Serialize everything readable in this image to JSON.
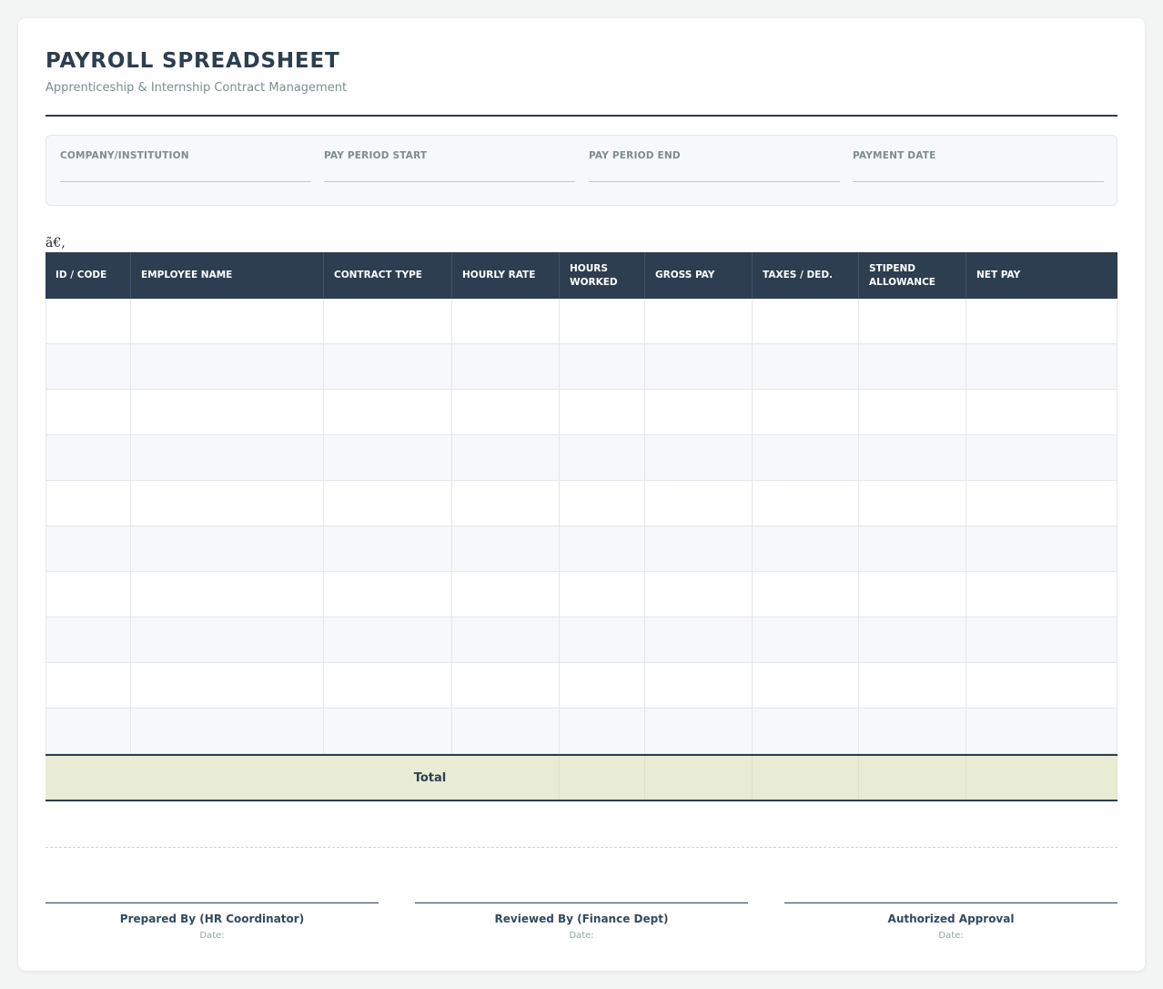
{
  "header": {
    "title": "PAYROLL SPREADSHEET",
    "subtitle": "Apprenticeship & Internship Contract Management"
  },
  "meta_fields": [
    {
      "label": "COMPANY/INSTITUTION",
      "value": ""
    },
    {
      "label": "PAY PERIOD START",
      "value": ""
    },
    {
      "label": "PAY PERIOD END",
      "value": ""
    },
    {
      "label": "PAYMENT DATE",
      "value": ""
    }
  ],
  "stray_text": "ã€‚",
  "table": {
    "columns": [
      {
        "label": "ID / CODE"
      },
      {
        "label": "EMPLOYEE NAME"
      },
      {
        "label": "CONTRACT TYPE"
      },
      {
        "label": "HOURLY RATE"
      },
      {
        "label": "HOURS\nWORKED"
      },
      {
        "label": "GROSS PAY"
      },
      {
        "label": "TAXES / DED."
      },
      {
        "label": "STIPEND\nALLOWANCE"
      },
      {
        "label": "NET PAY"
      }
    ],
    "rows": [
      [
        "",
        "",
        "",
        "",
        "",
        "",
        "",
        "",
        ""
      ],
      [
        "",
        "",
        "",
        "",
        "",
        "",
        "",
        "",
        ""
      ],
      [
        "",
        "",
        "",
        "",
        "",
        "",
        "",
        "",
        ""
      ],
      [
        "",
        "",
        "",
        "",
        "",
        "",
        "",
        "",
        ""
      ],
      [
        "",
        "",
        "",
        "",
        "",
        "",
        "",
        "",
        ""
      ],
      [
        "",
        "",
        "",
        "",
        "",
        "",
        "",
        "",
        ""
      ],
      [
        "",
        "",
        "",
        "",
        "",
        "",
        "",
        "",
        ""
      ],
      [
        "",
        "",
        "",
        "",
        "",
        "",
        "",
        "",
        ""
      ],
      [
        "",
        "",
        "",
        "",
        "",
        "",
        "",
        "",
        ""
      ],
      [
        "",
        "",
        "",
        "",
        "",
        "",
        "",
        "",
        ""
      ]
    ],
    "total_label": "Total",
    "totals": [
      "",
      "",
      "",
      "",
      "",
      ""
    ]
  },
  "signatures": [
    {
      "title": "Prepared By (HR Coordinator)",
      "date_label": "Date:"
    },
    {
      "title": "Reviewed By (Finance Dept)",
      "date_label": "Date:"
    },
    {
      "title": "Authorized Approval",
      "date_label": "Date:"
    }
  ]
}
